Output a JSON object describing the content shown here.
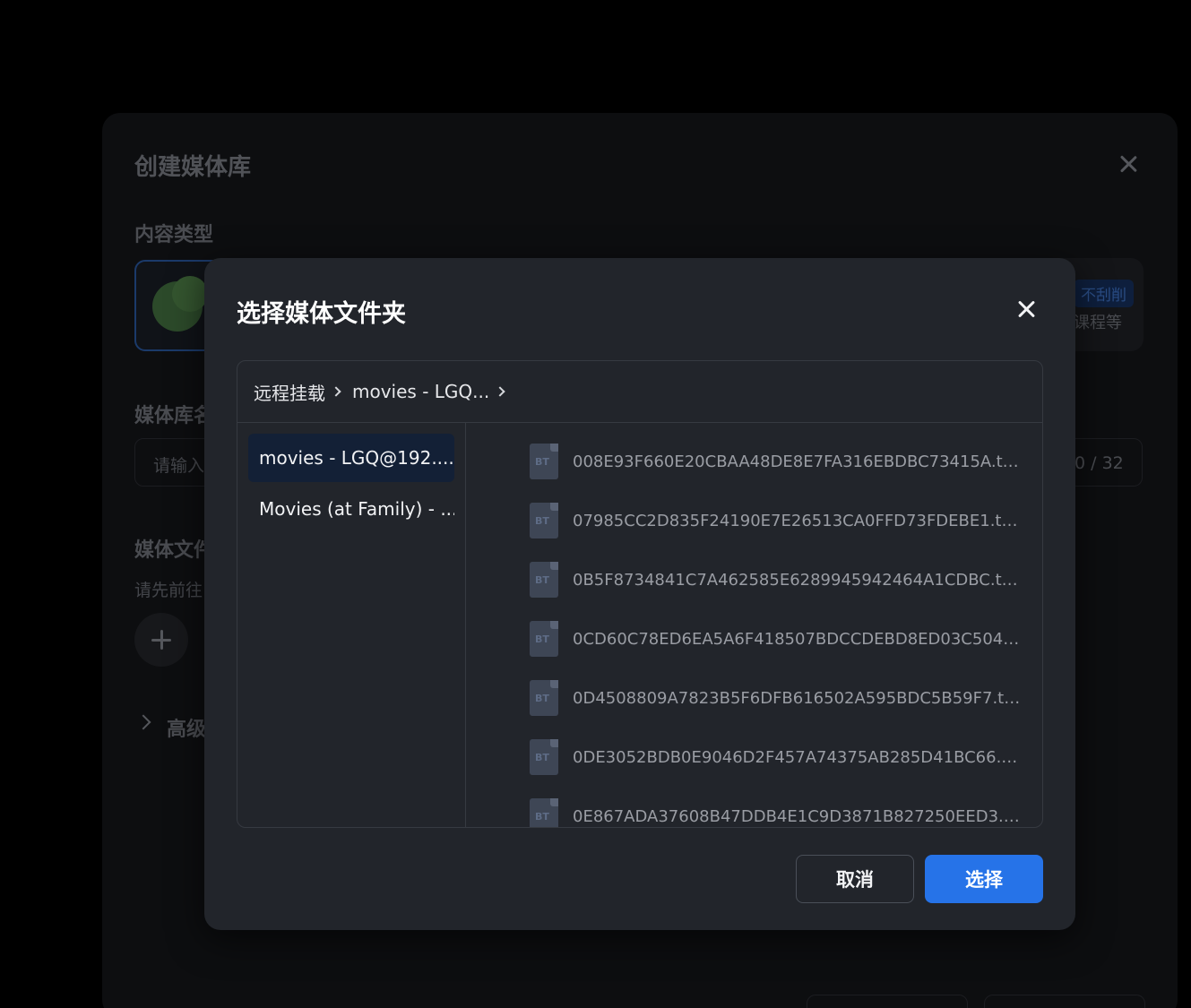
{
  "background_dialog": {
    "title": "创建媒体库",
    "content_type_label": "内容类型",
    "library_name_label": "媒体库名",
    "library_name_placeholder": "请输入",
    "name_counter": "0 / 32",
    "folder_label": "媒体文件",
    "folder_hint": "请先前往",
    "type_tag": "不刮削",
    "type_tag_sub": "课程等",
    "advanced_label": "高级"
  },
  "modal": {
    "title": "选择媒体文件夹",
    "breadcrumb": [
      "远程挂载",
      "movies - LGQ..."
    ],
    "drives": [
      {
        "label": "movies - LGQ@192....",
        "active": true
      },
      {
        "label": "Movies (at Family) - ...",
        "active": false
      }
    ],
    "files": [
      {
        "name": "008E93F660E20CBAA48DE8E7FA316EBDBC73415A.torre...",
        "icon": "bt-file-icon"
      },
      {
        "name": "07985CC2D835F24190E7E26513CA0FFD73FDEBE1.torrent",
        "icon": "bt-file-icon"
      },
      {
        "name": "0B5F8734841C7A462585E6289945942464A1CDBC.torre...",
        "icon": "bt-file-icon"
      },
      {
        "name": "0CD60C78ED6EA5A6F418507BDCCDEBD8ED03C504.tor...",
        "icon": "bt-file-icon"
      },
      {
        "name": "0D4508809A7823B5F6DFB616502A595BDC5B59F7.torr...",
        "icon": "bt-file-icon"
      },
      {
        "name": "0DE3052BDB0E9046D2F457A74375AB285D41BC66.torr...",
        "icon": "bt-file-icon"
      },
      {
        "name": "0E867ADA37608B47DDB4E1C9D3871B827250EED3.torr...",
        "icon": "bt-file-icon"
      }
    ],
    "file_icon_text": "BT",
    "cancel_label": "取消",
    "select_label": "选择"
  },
  "colors": {
    "accent": "#2673e8",
    "modal_bg": "#22252b",
    "active_item_bg": "#132036"
  }
}
